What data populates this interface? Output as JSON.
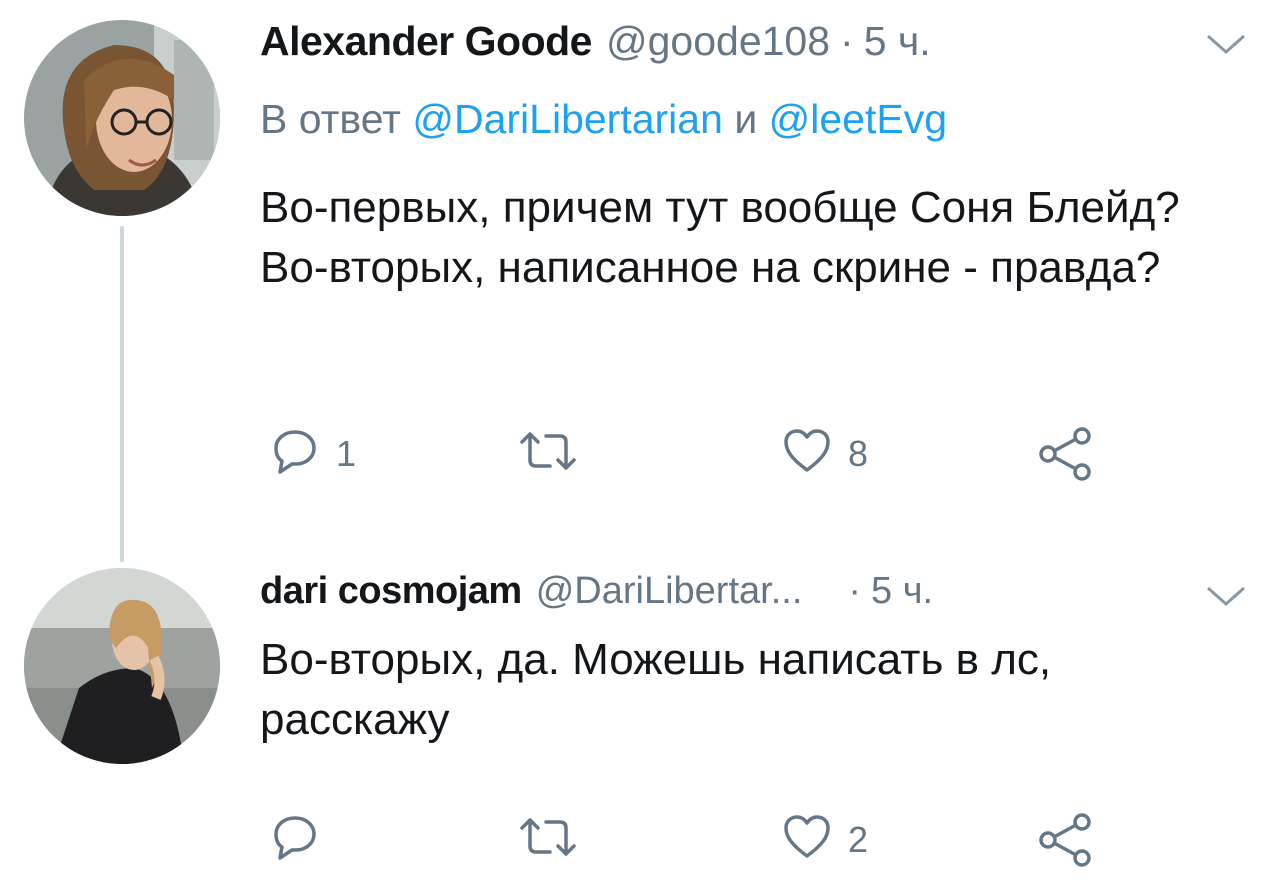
{
  "tweets": [
    {
      "name": "Alexander Goode",
      "handle": "@goode108",
      "separator": "·",
      "time": "5 ч.",
      "reply_prefix": "В ответ",
      "reply_mention_1": "@DariLibertarian",
      "reply_and": "и",
      "reply_mention_2": "@leetEvg",
      "text": "Во-первых, причем тут вообще Соня Блейд? Во-вторых, написанное на скрине - правда?",
      "reply_count": "1",
      "retweet_count": "",
      "like_count": "8"
    },
    {
      "name": "dari cosmojam",
      "handle": "@DariLibertar...",
      "separator": "·",
      "time": "5 ч.",
      "text": "Во-вторых, да. Можешь написать в лс, расскажу",
      "reply_count": "",
      "retweet_count": "",
      "like_count": "2"
    }
  ],
  "colors": {
    "text": "#14171a",
    "secondary": "#657786",
    "link": "#1da1f2",
    "thread_line": "#ccd6dd"
  },
  "icons": [
    "reply-icon",
    "retweet-icon",
    "like-icon",
    "share-icon",
    "chevron-down-icon"
  ]
}
